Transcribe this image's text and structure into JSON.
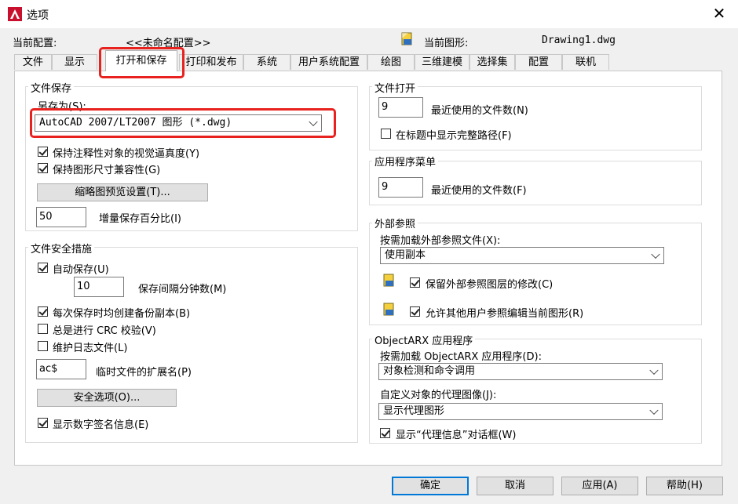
{
  "window": {
    "title": "选项"
  },
  "config": {
    "current_profile_label": "当前配置:",
    "current_profile_value": "<<未命名配置>>",
    "current_drawing_label": "当前图形:",
    "current_drawing_value": "Drawing1.dwg"
  },
  "tabs": [
    {
      "label": "文件"
    },
    {
      "label": "显示"
    },
    {
      "label": "打开和保存"
    },
    {
      "label": "打印和发布"
    },
    {
      "label": "系统"
    },
    {
      "label": "用户系统配置"
    },
    {
      "label": "绘图"
    },
    {
      "label": "三维建模"
    },
    {
      "label": "选择集"
    },
    {
      "label": "配置"
    },
    {
      "label": "联机"
    }
  ],
  "file_save": {
    "title": "文件保存",
    "save_as_label": "另存为(S):",
    "save_as_value": "AutoCAD 2007/LT2007 图形 (*.dwg)",
    "annot_visual": "保持注释性对象的视觉逼真度(Y)",
    "annot_visual_checked": true,
    "drawing_size": "保持图形尺寸兼容性(G)",
    "drawing_size_checked": true,
    "thumbnail_button": "缩略图预览设置(T)...",
    "incremental_value": "50",
    "incremental_label": "增量保存百分比(I)"
  },
  "file_safety": {
    "title": "文件安全措施",
    "autosave": "自动保存(U)",
    "autosave_checked": true,
    "interval_value": "10",
    "interval_label": "保存间隔分钟数(M)",
    "backup": "每次保存时均创建备份副本(B)",
    "backup_checked": true,
    "crc": "总是进行 CRC 校验(V)",
    "crc_checked": false,
    "log": "维护日志文件(L)",
    "log_checked": false,
    "temp_ext_value": "ac$",
    "temp_ext_label": "临时文件的扩展名(P)",
    "security_button": "安全选项(O)...",
    "digital_sig": "显示数字签名信息(E)",
    "digital_sig_checked": true
  },
  "file_open": {
    "title": "文件打开",
    "recent_value": "9",
    "recent_label": "最近使用的文件数(N)",
    "full_path": "在标题中显示完整路径(F)",
    "full_path_checked": false
  },
  "app_menu": {
    "title": "应用程序菜单",
    "recent_value": "9",
    "recent_label": "最近使用的文件数(F)"
  },
  "xref": {
    "title": "外部参照",
    "demand_label": "按需加载外部参照文件(X):",
    "demand_value": "使用副本",
    "retain": "保留外部参照图层的修改(C)",
    "retain_checked": true,
    "allow_edit": "允许其他用户参照编辑当前图形(R)",
    "allow_edit_checked": true
  },
  "objectarx": {
    "title": "ObjectARX 应用程序",
    "demand_label": "按需加载 ObjectARX 应用程序(D):",
    "demand_value": "对象检测和命令调用",
    "proxy_label": "自定义对象的代理图像(J):",
    "proxy_value": "显示代理图形",
    "proxy_info": "显示“代理信息”对话框(W)",
    "proxy_info_checked": true
  },
  "buttons": {
    "ok": "确定",
    "cancel": "取消",
    "apply": "应用(A)",
    "help": "帮助(H)"
  },
  "colors": {
    "highlight": "#e8231f",
    "accent": "#0078d7"
  }
}
